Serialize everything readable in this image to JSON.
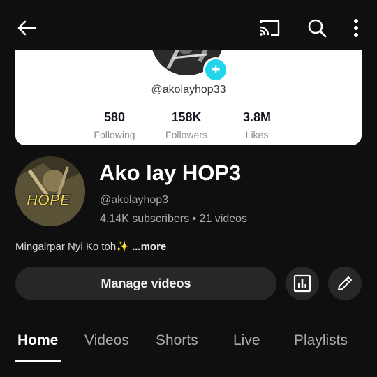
{
  "header": {
    "icons": [
      "back-arrow-icon",
      "cast-icon",
      "search-icon",
      "more-vert-icon"
    ]
  },
  "tiktok_card": {
    "handle": "@akolayhop33",
    "stats": [
      {
        "value": "580",
        "label": "Following"
      },
      {
        "value": "158K",
        "label": "Followers"
      },
      {
        "value": "3.8M",
        "label": "Likes"
      }
    ],
    "accent_color": "#20d5ec",
    "plus_symbol": "+"
  },
  "channel": {
    "name": "Ako lay HOP3",
    "handle": "@akolayhop3",
    "meta": "4.14K subscribers • 21 videos",
    "avatar_text": "HOPE",
    "description": "Mingalrpar Nyi Ko toh✨ ",
    "more_label": "...more"
  },
  "actions": {
    "manage_label": "Manage videos",
    "icons": [
      "analytics-icon",
      "edit-pencil-icon"
    ]
  },
  "tabs": [
    {
      "label": "Home",
      "active": true
    },
    {
      "label": "Videos",
      "active": false
    },
    {
      "label": "Shorts",
      "active": false
    },
    {
      "label": "Live",
      "active": false
    },
    {
      "label": "Playlists",
      "active": false
    }
  ],
  "colors": {
    "background": "#0f0f0f",
    "button_bg": "#272727",
    "secondary_text": "#aaaaaa"
  }
}
